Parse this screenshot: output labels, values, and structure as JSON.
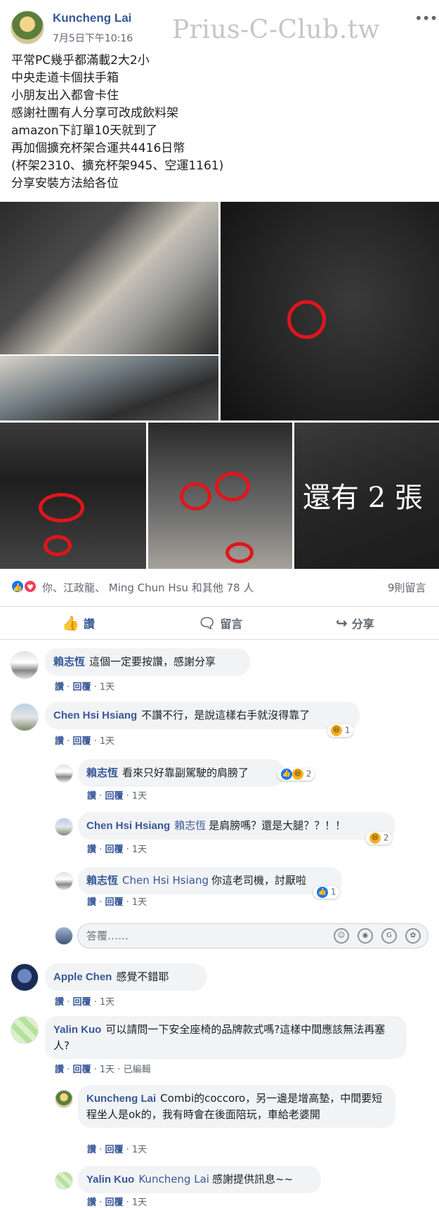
{
  "post": {
    "author": "Kuncheng Lai",
    "time": "7月5日下午10:16",
    "watermark": "Prius-C-Club.tw",
    "lines": [
      "平常PC幾乎都滿載2大2小",
      "中央走道卡個扶手箱",
      "小朋友出入都會卡住",
      "感謝社團有人分享可改成飲料架",
      "amazon下訂單10天就到了",
      "再加個擴充杯架合運共4416日幣",
      "(杯架2310、擴充杯架945、空運1161)",
      "分享安裝方法給各位"
    ],
    "more_photos": "還有 2 張"
  },
  "reactions": {
    "summary": "你、江政龍、 Ming Chun Hsu 和其他 78 人",
    "comment_count": "9則留言"
  },
  "actions": {
    "like": "讚",
    "comment": "留言",
    "share": "分享"
  },
  "comment_meta": {
    "like": "讚",
    "reply": "回覆",
    "edited": "已編輯",
    "dot": "·"
  },
  "reply_placeholder": "答覆……",
  "comments": [
    {
      "name": "賴志恆",
      "mention": "",
      "text": "這個一定要按讚，感謝分享",
      "time": "1天",
      "reaction": ""
    },
    {
      "name": "Chen Hsi Hsiang",
      "mention": "",
      "text": "不讚不行，是說這樣右手就沒得靠了",
      "time": "1天",
      "reaction": "1"
    },
    {
      "name": "賴志恆",
      "mention": "",
      "text": "看來只好靠副駕駛的肩膀了",
      "time": "1天",
      "reaction": "2"
    },
    {
      "name": "Chen Hsi Hsiang",
      "mention": "賴志恆",
      "text": "是肩膀嗎？還是大腿？？！！",
      "time": "1天",
      "reaction": "2"
    },
    {
      "name": "賴志恆",
      "mention": "Chen Hsi Hsiang",
      "text": "你這老司機，討厭啦",
      "time": "1天",
      "reaction": "1"
    },
    {
      "name": "Apple Chen",
      "mention": "",
      "text": "感覺不錯耶",
      "time": "1天",
      "reaction": ""
    },
    {
      "name": "Yalin Kuo",
      "mention": "",
      "text": "可以請問一下安全座椅的品牌款式嗎?這樣中間應該無法再塞人?",
      "time": "1天",
      "reaction": ""
    },
    {
      "name": "Kuncheng Lai",
      "mention": "",
      "text": "Combi的coccoro，另一邊是增高墊，中間要短程坐人是ok的，我有時會在後面陪玩，車給老婆開",
      "time": "1天",
      "reaction": ""
    },
    {
      "name": "Yalin Kuo",
      "mention": "Kuncheng Lai",
      "text": "感謝提供訊息~~",
      "time": "1天",
      "reaction": ""
    }
  ]
}
